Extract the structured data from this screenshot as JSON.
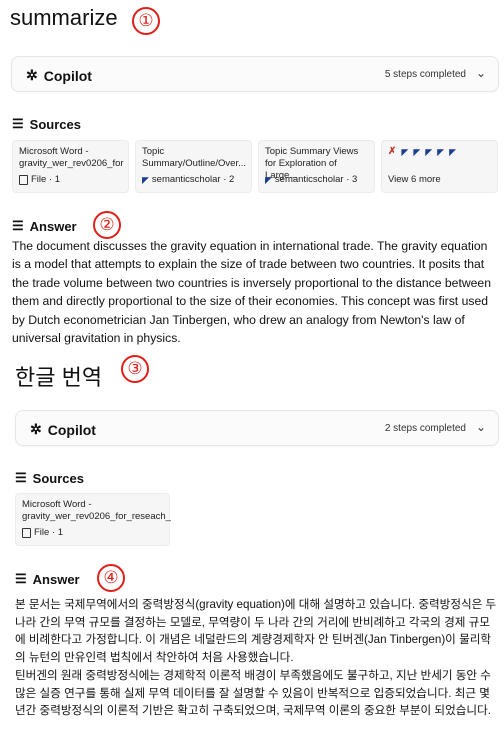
{
  "section1": {
    "query": "summarize",
    "marker": "①",
    "copilot": {
      "label": "Copilot",
      "steps": "5 steps completed"
    },
    "sources_title": "Sources",
    "sources": [
      {
        "title": "Microsoft Word - gravity_wer_rev0206_for",
        "meta": "File · 1",
        "kind": "file"
      },
      {
        "title": "Topic Summary/Outline/Over...",
        "meta": "semanticscholar · 2",
        "kind": "scholar"
      },
      {
        "title": "Topic Summary Views for Exploration of Large...",
        "meta": "semanticscholar · 3",
        "kind": "scholar"
      }
    ],
    "view_more": "View 6 more",
    "answer_title": "Answer",
    "answer_marker": "②",
    "answer_text": "The document discusses the gravity equation in international trade. The gravity equation is a model that attempts to explain the size of trade between two countries. It posits that the trade volume between two countries is inversely proportional to the distance between them and directly proportional to the size of their economies. This concept was first used by Dutch econometrician Jan Tinbergen, who drew an analogy from Newton's law of universal gravitation in physics."
  },
  "section2": {
    "query": "한글 번역",
    "marker": "③",
    "copilot": {
      "label": "Copilot",
      "steps": "2 steps completed"
    },
    "sources_title": "Sources",
    "sources": [
      {
        "title": "Microsoft Word - gravity_wer_rev0206_for_reseach_",
        "meta": "File · 1",
        "kind": "file"
      }
    ],
    "answer_title": "Answer",
    "answer_marker": "④",
    "answer_p1": "본 문서는 국제무역에서의 중력방정식(gravity equation)에 대해 설명하고 있습니다. 중력방정식은 두 나라 간의 무역 규모를 결정하는 모델로, 무역량이 두 나라 간의 거리에 반비례하고 각국의 경제 규모에 비례한다고 가정합니다. 이 개념은 네덜란드의 계량경제학자 안 틴버겐(Jan Tinbergen)이 물리학의 뉴턴의 만유인력 법칙에서 착안하여 처음 사용했습니다.",
    "answer_p2": "틴버겐의 원래 중력방정식에는 경제학적 이론적 배경이 부족했음에도 불구하고, 지난 반세기 동안 수많은 실증 연구를 통해 실제 무역 데이터를 잘 설명할 수 있음이 반복적으로 입증되었습니다. 최근 몇 년간 중력방정식의 이론적 기반은 확고히 구축되었으며, 국제무역 이론의 중요한 부분이 되었습니다."
  },
  "colors": {
    "marker_red": "#e0201a",
    "scholar_blue": "#1b3d8f"
  }
}
